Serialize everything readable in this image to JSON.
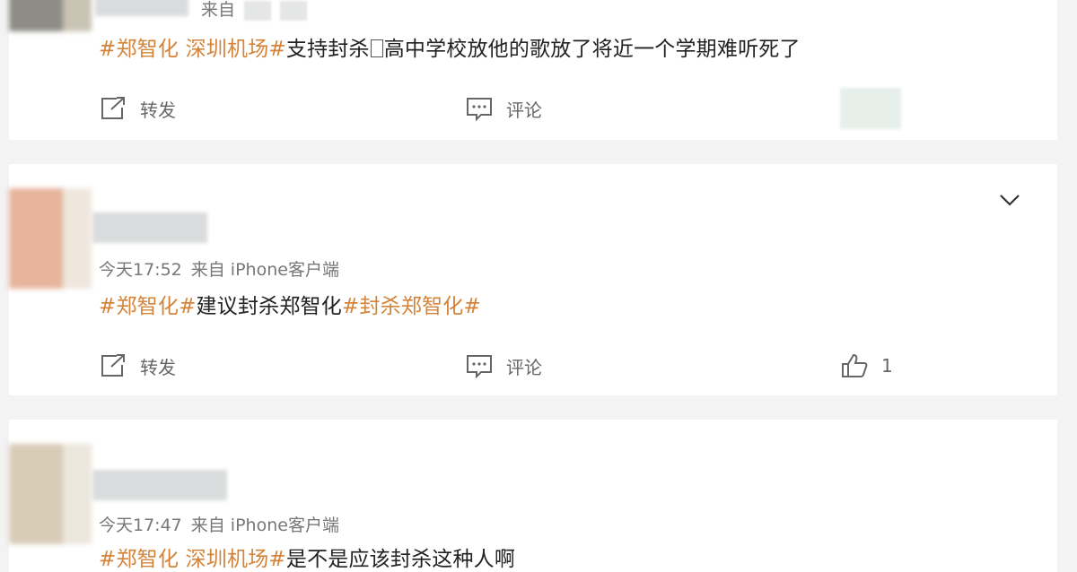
{
  "posts": [
    {
      "source_prefix": "来自",
      "tags": [
        "#郑智化",
        "深圳机场#"
      ],
      "text": "支持封杀",
      "text2": "高中学校放他的歌放了将近一个学期难听死了",
      "repost_label": "转发",
      "comment_label": "评论"
    },
    {
      "time": "今天17:52",
      "source": "来自 iPhone客户端",
      "tag1": "#郑智化#",
      "text": "建议封杀郑智化",
      "tag2": "#封杀郑智化#",
      "repost_label": "转发",
      "comment_label": "评论",
      "like_count": "1"
    },
    {
      "time": "今天17:47",
      "source": "来自 iPhone客户端",
      "tags": [
        "#郑智化",
        "深圳机场#"
      ],
      "text": "是不是应该封杀这种人啊"
    }
  ],
  "colors": {
    "tag": "#d4843a",
    "background": "#f3f3f4",
    "card": "#ffffff"
  },
  "icons": [
    "repost-icon",
    "comment-icon",
    "like-icon",
    "chevron-down-icon"
  ]
}
